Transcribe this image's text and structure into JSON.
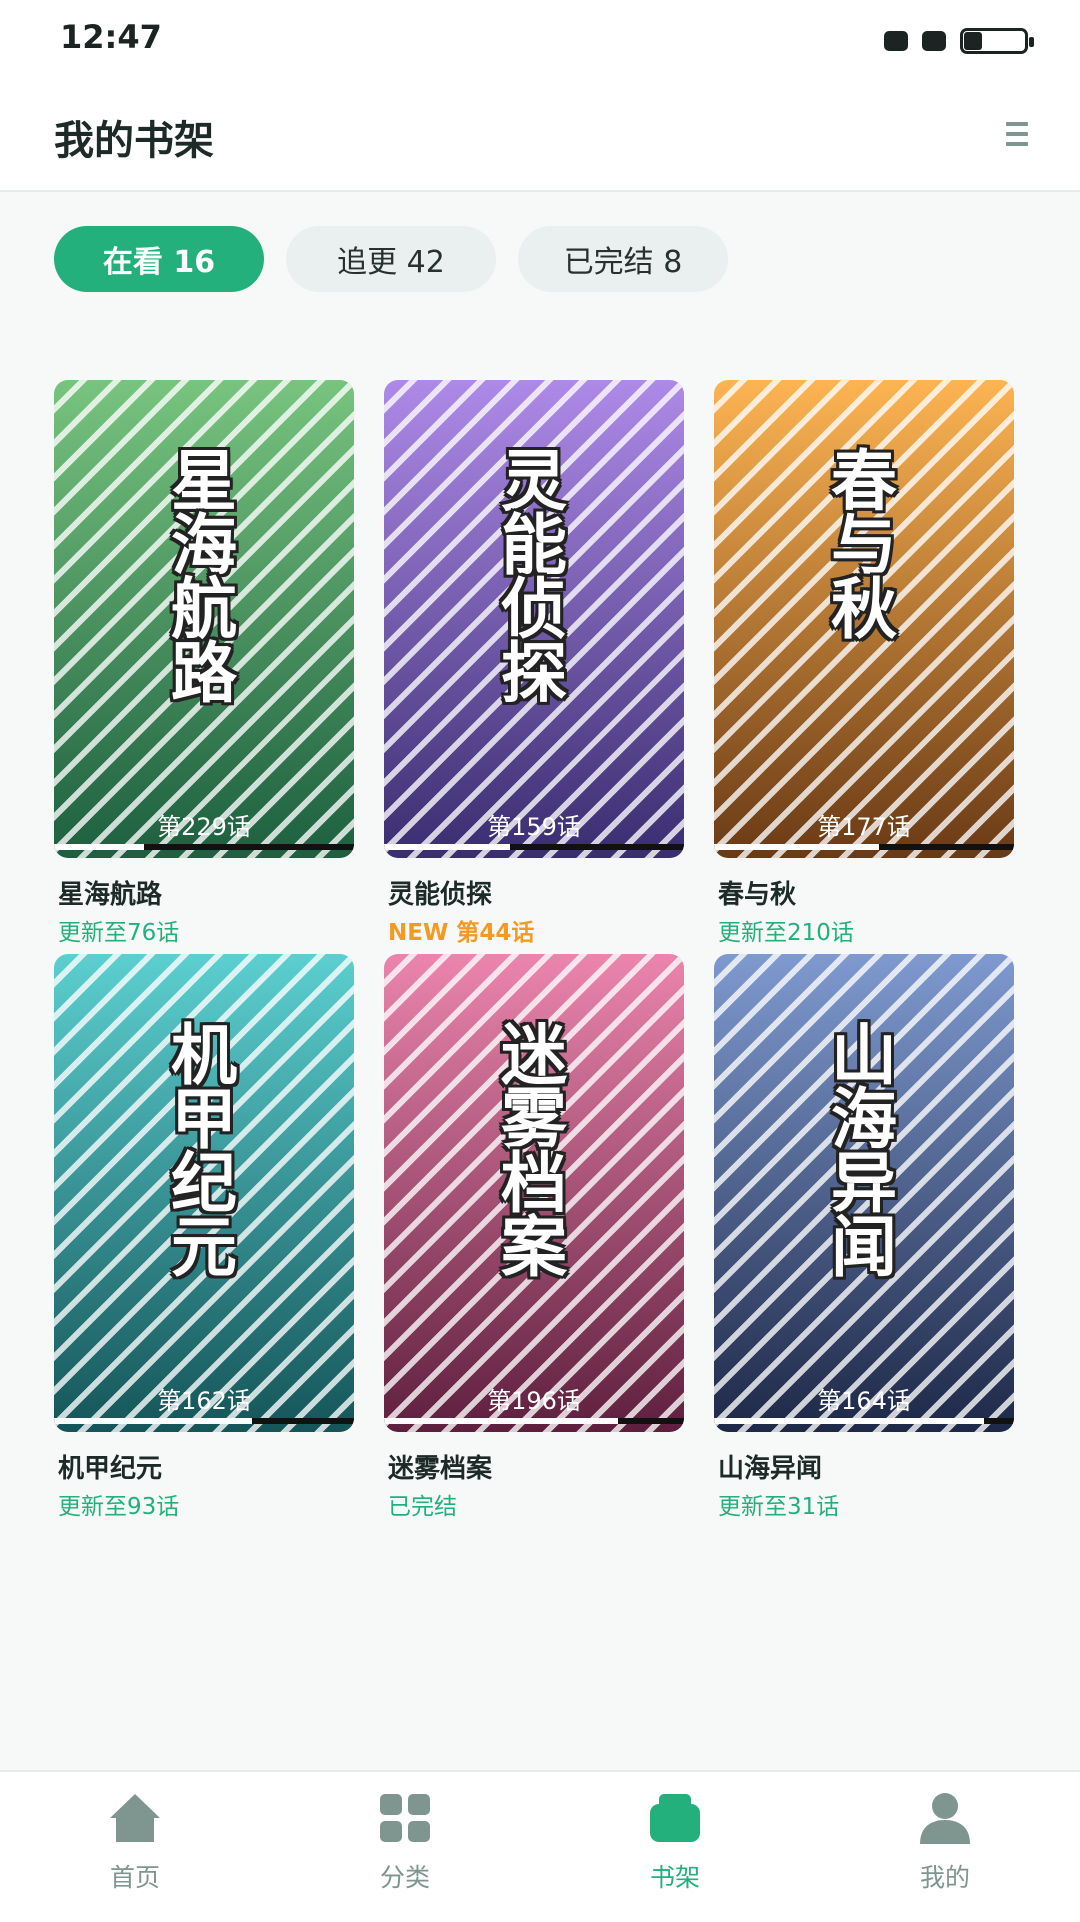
{
  "status_bar": {
    "time": "12:47"
  },
  "header": {
    "title": "我的书架"
  },
  "tabs": [
    {
      "label": "在看 16",
      "active": true
    },
    {
      "label": "追更 42",
      "active": false
    },
    {
      "label": "已完结 8",
      "active": false
    }
  ],
  "books": [
    {
      "title": "星海航路",
      "cover_title": [
        "星",
        "海",
        "航",
        "路"
      ],
      "episode": "第229话",
      "update": "更新至76话",
      "is_new": false,
      "progress": 0.3,
      "color_top": "#78c47f",
      "color_bottom": "#1d5f40"
    },
    {
      "title": "灵能侦探",
      "cover_title": [
        "灵",
        "能",
        "侦",
        "探"
      ],
      "episode": "第159话",
      "update": "NEW 第44话",
      "is_new": true,
      "progress": 0.42,
      "color_top": "#ae8ae8",
      "color_bottom": "#3a2d70"
    },
    {
      "title": "春与秋",
      "cover_title": [
        "春",
        "与",
        "秋"
      ],
      "episode": "第177话",
      "update": "更新至210话",
      "is_new": false,
      "progress": 0.55,
      "color_top": "#fdb452",
      "color_bottom": "#6a3a16"
    },
    {
      "title": "机甲纪元",
      "cover_title": [
        "机",
        "甲",
        "纪",
        "元"
      ],
      "episode": "第162话",
      "update": "更新至93话",
      "is_new": false,
      "progress": 0.66,
      "color_top": "#5ccfd0",
      "color_bottom": "#155559"
    },
    {
      "title": "迷雾档案",
      "cover_title": [
        "迷",
        "雾",
        "档",
        "案"
      ],
      "episode": "第196话",
      "update": "已完结",
      "is_new": false,
      "progress": 0.78,
      "color_top": "#ec85ad",
      "color_bottom": "#5e1f3e"
    },
    {
      "title": "山海异闻",
      "cover_title": [
        "山",
        "海",
        "异",
        "闻"
      ],
      "episode": "第164话",
      "update": "更新至31话",
      "is_new": false,
      "progress": 0.9,
      "color_top": "#7f9ad0",
      "color_bottom": "#1e2847"
    }
  ],
  "bottom_nav": [
    {
      "label": "首页",
      "icon": "home-icon",
      "active": false
    },
    {
      "label": "分类",
      "icon": "grid-icon",
      "active": false
    },
    {
      "label": "书架",
      "icon": "bookshelf-icon",
      "active": true
    },
    {
      "label": "我的",
      "icon": "profile-icon",
      "active": false
    }
  ],
  "colors": {
    "accent": "#23b07c",
    "new_badge": "#f49a23",
    "inactive": "#7f9590"
  }
}
